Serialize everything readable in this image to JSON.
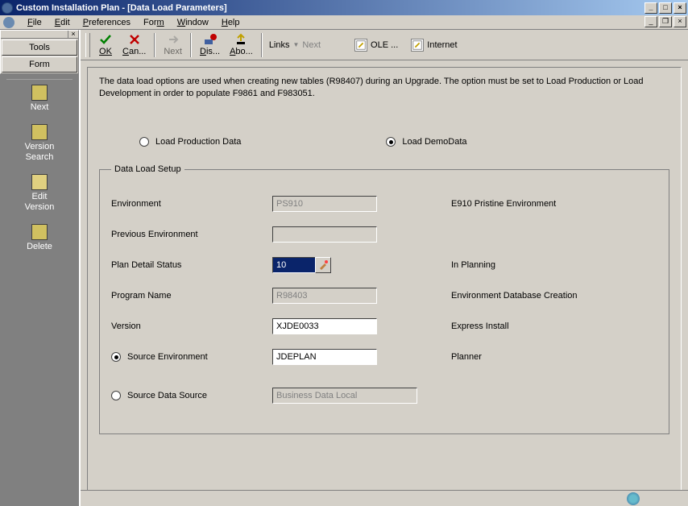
{
  "titlebar": {
    "title": "Custom Installation Plan - [Data Load Parameters]"
  },
  "menubar": {
    "file": "File",
    "edit": "Edit",
    "preferences": "Preferences",
    "form": "Form",
    "window": "Window",
    "help": "Help"
  },
  "toolpanel": {
    "tools": "Tools",
    "form": "Form"
  },
  "sidebar": {
    "next": "Next",
    "version_search": "Version\nSearch",
    "edit_version": "Edit\nVersion",
    "delete": "Delete"
  },
  "toolbar": {
    "ok": "OK",
    "cancel": "Can...",
    "next": "Next",
    "display": "Dis...",
    "about": "Abo...",
    "links": "Links",
    "links_next": "Next",
    "ole": "OLE ...",
    "internet": "Internet"
  },
  "form": {
    "description": "The data load options are used when creating new tables (R98407) during an Upgrade.  The option must be set to Load Production or Load Development in order to populate F9861 and F983051.",
    "radio_production": "Load Production Data",
    "radio_demo": "Load DemoData",
    "radio_selected": "demo",
    "fieldset_legend": "Data Load Setup",
    "rows": {
      "environment": {
        "label": "Environment",
        "value": "PS910",
        "desc": "E910 Pristine Environment"
      },
      "prev_env": {
        "label": "Previous Environment",
        "value": "",
        "desc": ""
      },
      "plan_status": {
        "label": "Plan Detail Status",
        "value": "10",
        "desc": "In Planning"
      },
      "program": {
        "label": "Program Name",
        "value": "R98403",
        "desc": "Environment Database Creation"
      },
      "version": {
        "label": "Version",
        "value": "XJDE0033",
        "desc": "Express Install"
      },
      "src_env": {
        "label": "Source Environment",
        "value": "JDEPLAN",
        "desc": "Planner"
      },
      "src_ds": {
        "label": "Source Data Source",
        "value": "Business Data Local",
        "desc": ""
      }
    },
    "src_radio_selected": "env"
  }
}
